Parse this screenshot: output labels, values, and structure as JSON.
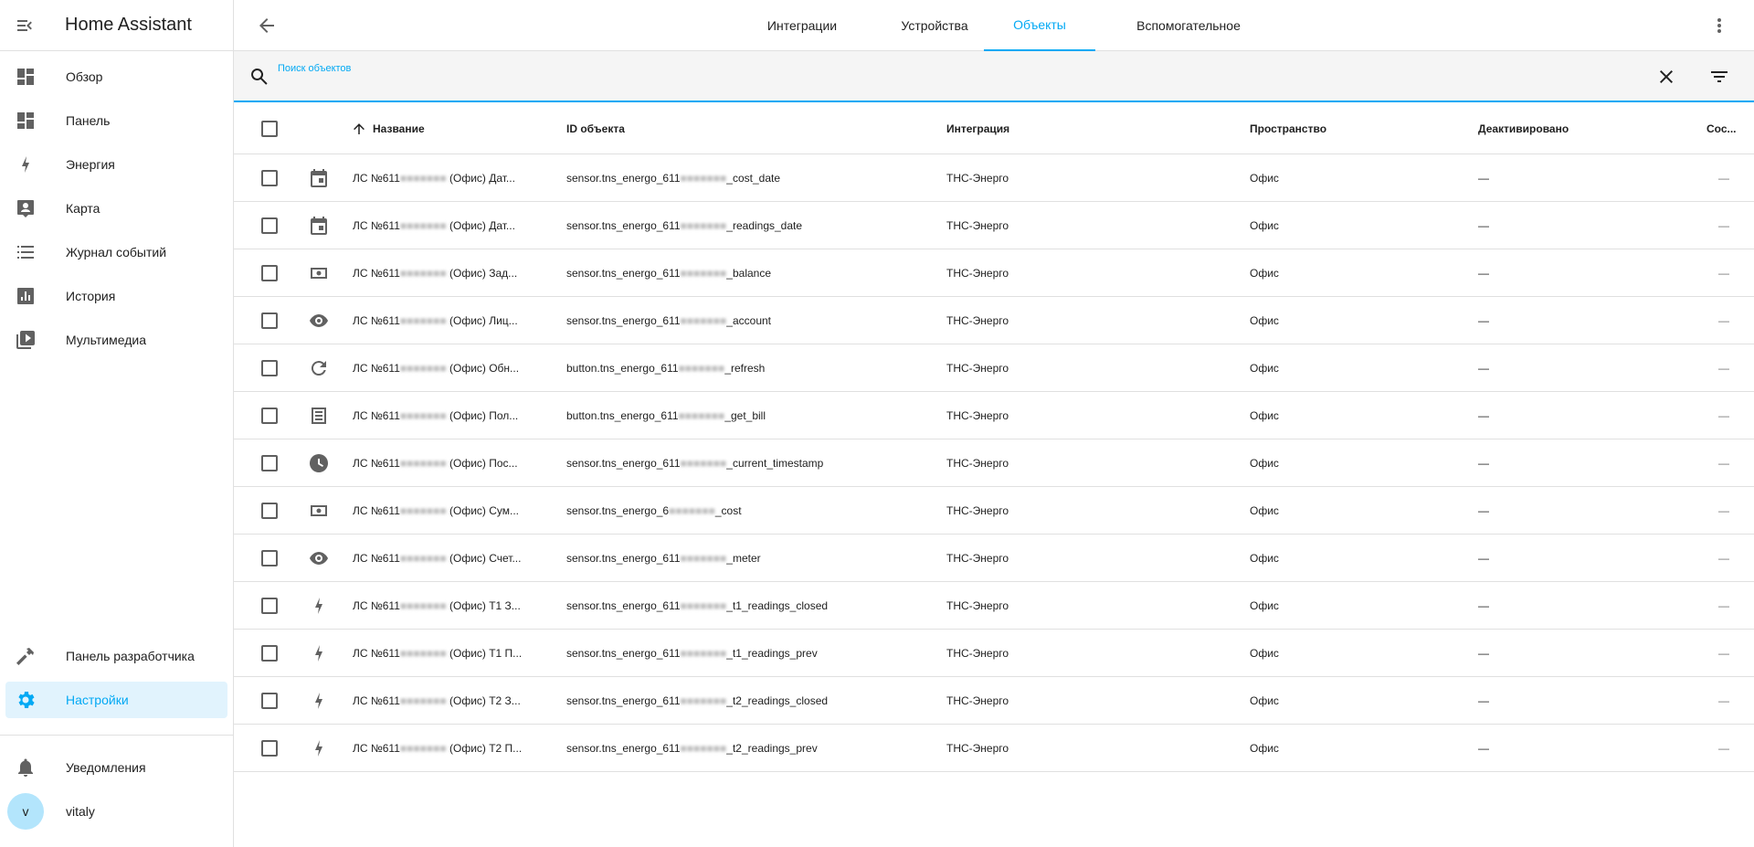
{
  "app": {
    "title": "Home Assistant"
  },
  "sidebar": {
    "items": [
      {
        "label": "Обзор",
        "icon": "dashboard-icon"
      },
      {
        "label": "Панель",
        "icon": "dashboard-icon"
      },
      {
        "label": "Энергия",
        "icon": "lightning-icon"
      },
      {
        "label": "Карта",
        "icon": "map-icon"
      },
      {
        "label": "Журнал событий",
        "icon": "list-icon"
      },
      {
        "label": "История",
        "icon": "chart-icon"
      },
      {
        "label": "Мультимедиа",
        "icon": "play-box-icon"
      }
    ],
    "bottom": [
      {
        "label": "Панель разработчика",
        "icon": "hammer-icon"
      },
      {
        "label": "Настройки",
        "icon": "cog-icon",
        "active": true
      }
    ],
    "notifications_label": "Уведомления",
    "user": {
      "initial": "v",
      "name": "vitaly"
    }
  },
  "tabs": [
    {
      "label": "Интеграции"
    },
    {
      "label": "Устройства"
    },
    {
      "label": "Объекты",
      "active": true
    },
    {
      "label": "Вспомогательное"
    }
  ],
  "search": {
    "label": "Поиск объектов",
    "value": ""
  },
  "table": {
    "headers": {
      "name": "Название",
      "entity_id": "ID объекта",
      "integration": "Интеграция",
      "area": "Пространство",
      "disabled": "Деактивировано",
      "status": "Сос..."
    },
    "rows": [
      {
        "icon": "calendar-icon",
        "name_prefix": "ЛС №611",
        "name_suffix": "(Офис) Дат...",
        "id_prefix": "sensor.tns_energo_611",
        "id_suffix": "_cost_date",
        "integration": "ТНС-Энерго",
        "area": "Офис",
        "disabled": "—",
        "status": "—"
      },
      {
        "icon": "calendar-icon",
        "name_prefix": "ЛС №611",
        "name_suffix": "(Офис) Дат...",
        "id_prefix": "sensor.tns_energo_611",
        "id_suffix": "_readings_date",
        "integration": "ТНС-Энерго",
        "area": "Офис",
        "disabled": "—",
        "status": "—"
      },
      {
        "icon": "cash-icon",
        "name_prefix": "ЛС №611",
        "name_suffix": "(Офис) Зад...",
        "id_prefix": "sensor.tns_energo_611",
        "id_suffix": "_balance",
        "integration": "ТНС-Энерго",
        "area": "Офис",
        "disabled": "—",
        "status": "—"
      },
      {
        "icon": "eye-icon",
        "name_prefix": "ЛС №611",
        "name_suffix": "(Офис) Лиц...",
        "id_prefix": "sensor.tns_energo_611",
        "id_suffix": "_account",
        "integration": "ТНС-Энерго",
        "area": "Офис",
        "disabled": "—",
        "status": "—"
      },
      {
        "icon": "refresh-icon",
        "name_prefix": "ЛС №611",
        "name_suffix": "(Офис) Обн...",
        "id_prefix": "button.tns_energo_611",
        "id_suffix": "_refresh",
        "integration": "ТНС-Энерго",
        "area": "Офис",
        "disabled": "—",
        "status": "—"
      },
      {
        "icon": "receipt-icon",
        "name_prefix": "ЛС №611",
        "name_suffix": "(Офис) Пол...",
        "id_prefix": "button.tns_energo_611",
        "id_suffix": "_get_bill",
        "integration": "ТНС-Энерго",
        "area": "Офис",
        "disabled": "—",
        "status": "—"
      },
      {
        "icon": "clock-icon",
        "name_prefix": "ЛС №611",
        "name_suffix": "(Офис) Пос...",
        "id_prefix": "sensor.tns_energo_611",
        "id_suffix": "_current_timestamp",
        "integration": "ТНС-Энерго",
        "area": "Офис",
        "disabled": "—",
        "status": "—"
      },
      {
        "icon": "cash-icon",
        "name_prefix": "ЛС №611",
        "name_suffix": "(Офис) Сум...",
        "id_prefix": "sensor.tns_energo_6",
        "id_suffix": "_cost",
        "integration": "ТНС-Энерго",
        "area": "Офис",
        "disabled": "—",
        "status": "—"
      },
      {
        "icon": "eye-icon",
        "name_prefix": "ЛС №611",
        "name_suffix": "(Офис) Счет...",
        "id_prefix": "sensor.tns_energo_611",
        "id_suffix": "_meter",
        "integration": "ТНС-Энерго",
        "area": "Офис",
        "disabled": "—",
        "status": "—"
      },
      {
        "icon": "lightning-icon",
        "name_prefix": "ЛС №611",
        "name_suffix": "(Офис) Т1 З...",
        "id_prefix": "sensor.tns_energo_611",
        "id_suffix": "_t1_readings_closed",
        "integration": "ТНС-Энерго",
        "area": "Офис",
        "disabled": "—",
        "status": "—"
      },
      {
        "icon": "lightning-icon",
        "name_prefix": "ЛС №611",
        "name_suffix": "(Офис) Т1 П...",
        "id_prefix": "sensor.tns_energo_611",
        "id_suffix": "_t1_readings_prev",
        "integration": "ТНС-Энерго",
        "area": "Офис",
        "disabled": "—",
        "status": "—"
      },
      {
        "icon": "lightning-icon",
        "name_prefix": "ЛС №611",
        "name_suffix": "(Офис) Т2 З...",
        "id_prefix": "sensor.tns_energo_611",
        "id_suffix": "_t2_readings_closed",
        "integration": "ТНС-Энерго",
        "area": "Офис",
        "disabled": "—",
        "status": "—"
      },
      {
        "icon": "lightning-icon",
        "name_prefix": "ЛС №611",
        "name_suffix": "(Офис) Т2 П...",
        "id_prefix": "sensor.tns_energo_611",
        "id_suffix": "_t2_readings_prev",
        "integration": "ТНС-Энерго",
        "area": "Офис",
        "disabled": "—",
        "status": "—"
      }
    ]
  },
  "colors": {
    "accent": "#03a9f4",
    "icon": "#616161",
    "active_bg": "#e1f3fd"
  }
}
